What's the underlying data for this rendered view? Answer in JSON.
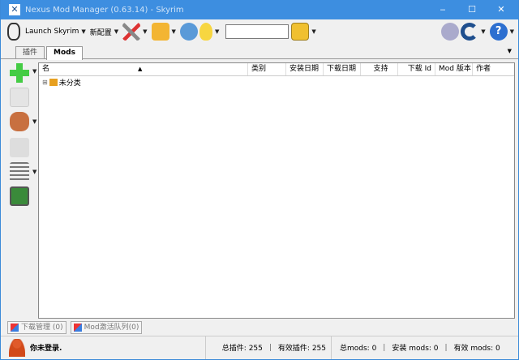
{
  "title": "Nexus Mod Manager (0.63.14) - Skyrim",
  "window_controls": {
    "minimize": "‒",
    "maximize": "☐",
    "close": "✕"
  },
  "toolbar": {
    "launch": "Launch Skyrim",
    "profile": "新配置",
    "search_value": ""
  },
  "tabs": [
    {
      "label": "插件"
    },
    {
      "label": "Mods"
    }
  ],
  "grid": {
    "columns": [
      "名",
      "类别",
      "安装日期",
      "下载日期",
      "支持",
      "下载 Id",
      "Mod 版本",
      "作者"
    ],
    "rows": [
      {
        "expander": "⊞",
        "label": "未分类"
      }
    ]
  },
  "bottom_tabs": [
    {
      "label": "下载管理 (0)"
    },
    {
      "label": "Mod激活队列(0)"
    }
  ],
  "status": {
    "login": "你未登录.",
    "total_plugins": "总插件: 255",
    "active_plugins": "有效插件:   255",
    "total_mods": "总mods: 0",
    "installed_mods": "安装 mods: 0",
    "active_mods": "有效 mods: 0",
    "divider": "|"
  }
}
